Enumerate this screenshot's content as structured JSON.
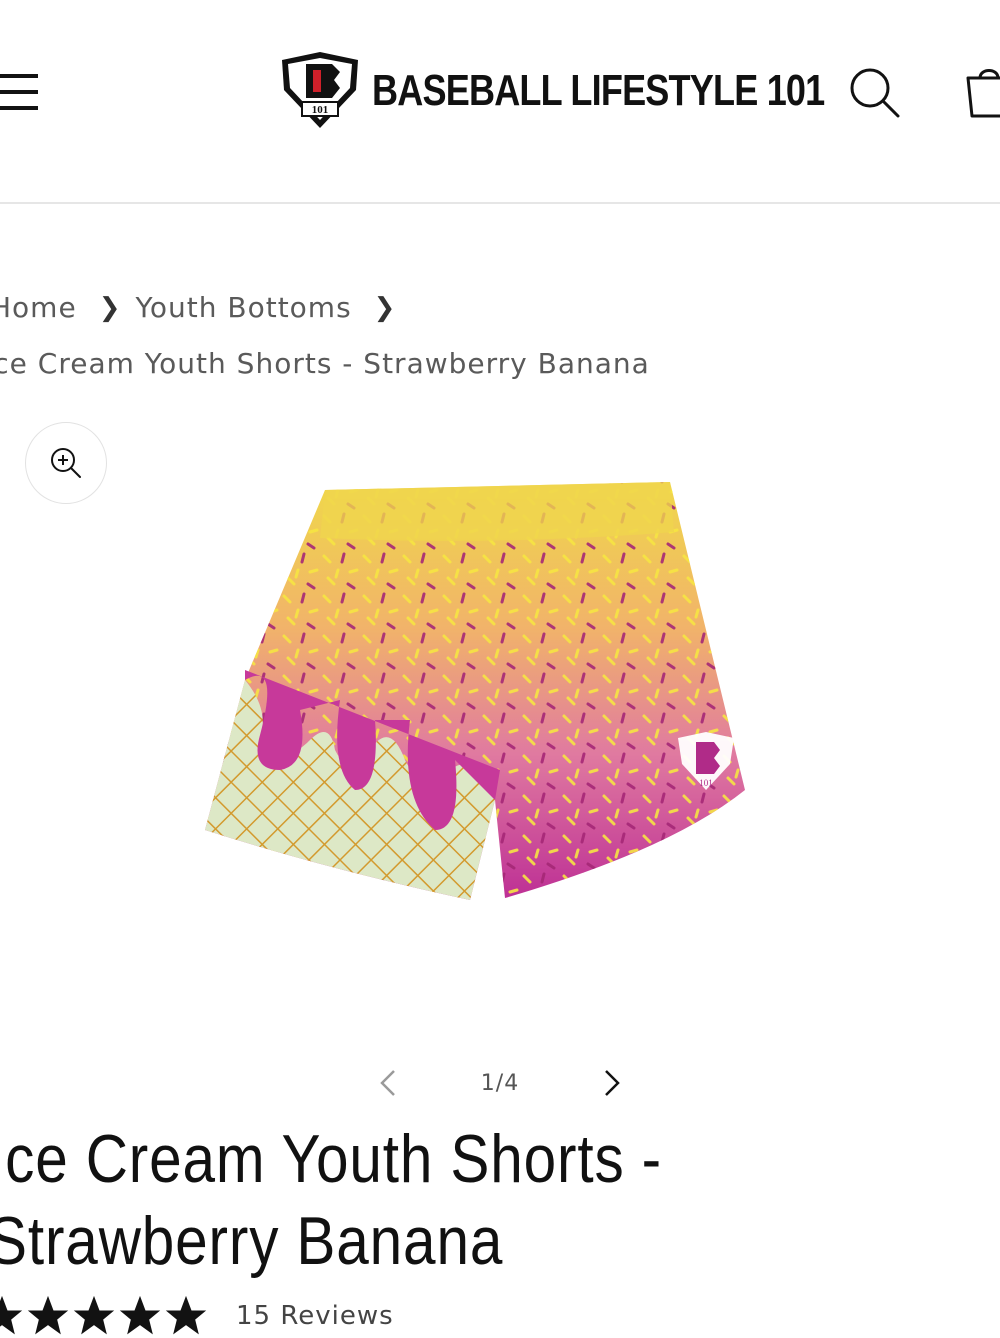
{
  "header": {
    "brand": "BASEBALL LIFESTYLE 101",
    "logo_text": "101"
  },
  "breadcrumb": {
    "items": [
      "Home",
      "Youth Bottoms"
    ],
    "current": "Ice Cream Youth Shorts - Strawberry Banana"
  },
  "gallery": {
    "counter": "1/4",
    "logo_text": "101"
  },
  "product": {
    "title": "Ice Cream Youth Shorts - Strawberry Banana",
    "rating": 5,
    "reviews": "15 Reviews"
  },
  "colors": {
    "text": "#121212",
    "muted": "#5a5a5a",
    "yellow": "#f4e04d",
    "pink": "#c7399a",
    "cone": "#d9e8c7",
    "waffle": "#d49a2a"
  }
}
